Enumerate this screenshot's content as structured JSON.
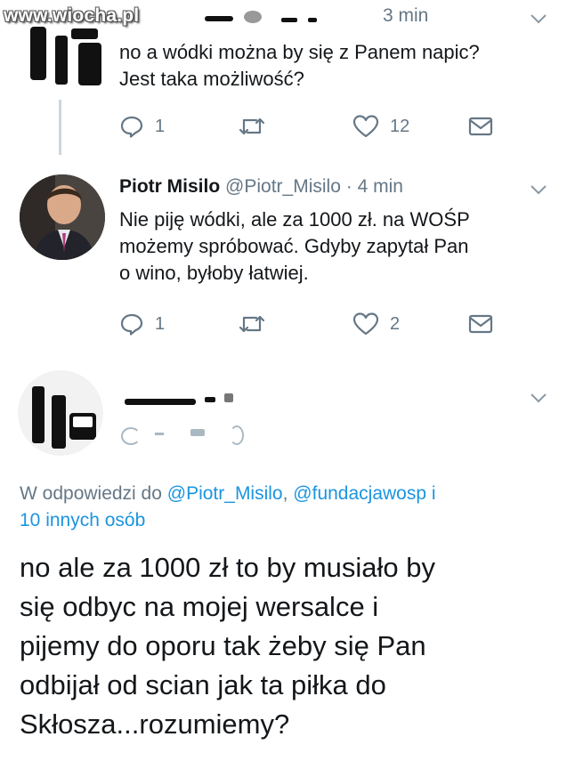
{
  "watermark": "www.wiocha.pl",
  "tweet1": {
    "time": "3 min",
    "text_line1": "no a wódki można by się z Panem napic?",
    "text_line2": "Jest taka możliwość?",
    "actions": {
      "reply_count": "1",
      "retweet_count": "",
      "like_count": "12"
    }
  },
  "tweet2": {
    "name": "Piotr Misilo",
    "handle": "@Piotr_Misilo",
    "separator": "·",
    "time": "4 min",
    "text_line1": "Nie piję wódki, ale za 1000 zł. na WOŚP",
    "text_line2": "możemy spróbować. Gdyby zapytał Pan",
    "text_line3": "o wino, byłoby łatwiej.",
    "actions": {
      "reply_count": "1",
      "retweet_count": "",
      "like_count": "2"
    }
  },
  "tweet3": {
    "reply_prefix": "W odpowiedzi do ",
    "reply_mention1": "@Piotr_Misilo",
    "reply_sep": ", ",
    "reply_mention2": "@fundacjawosp",
    "reply_suffix": " i",
    "reply_line2": "10 innych osób",
    "text_line1": "no ale za 1000 zł to by musiało by",
    "text_line2": "się odbyc na mojej wersalce i",
    "text_line3": "pijemy do oporu tak żeby się Pan",
    "text_line4": "odbijał od scian jak ta piłka do",
    "text_line5": "Skłosza...rozumiemy?"
  },
  "icons": {
    "reply": "reply-bubble-icon",
    "retweet": "retweet-icon",
    "like": "heart-icon",
    "dm": "envelope-icon",
    "more": "chevron-down-icon"
  },
  "colors": {
    "link": "#1b95e0",
    "muted": "#657786",
    "text": "#14171a",
    "line": "#ccd6dd"
  }
}
